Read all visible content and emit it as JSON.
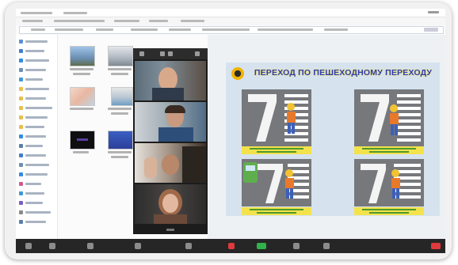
{
  "slide": {
    "title": "ПЕРЕХОД ПО ПЕШЕХОДНОМУ ПЕРЕХОДУ",
    "title_color": "#2b3db4",
    "title_glow": "#f6e25a",
    "background": "#d6e3ee",
    "caption_color": "#f3e24c",
    "caption_text_color": "#4d9a2c",
    "panels": [
      {
        "illustration": "pedestrian-crossing-child"
      },
      {
        "illustration": "pedestrian-crossing-child"
      },
      {
        "illustration": "pedestrian-crossing-child-with-car"
      },
      {
        "illustration": "pedestrian-crossing-child"
      }
    ]
  },
  "explorer": {
    "nav_icons": [
      "quick-access-icon",
      "desktop-icon",
      "downloads-icon",
      "documents-icon",
      "pictures-icon",
      "folder-icon",
      "folder-icon",
      "folder-icon",
      "folder-icon",
      "folder-icon",
      "onedrive-icon",
      "this-pc-icon",
      "desktop-icon",
      "documents-icon",
      "downloads-icon",
      "music-icon",
      "pictures-icon",
      "videos-icon",
      "local-disk-icon",
      "network-icon"
    ],
    "thumbnails": [
      "image-file-icon",
      "image-file-icon",
      "image-file-icon",
      "image-file-icon",
      "video-file-icon",
      "presentation-file-icon"
    ]
  },
  "gallery": {
    "participants": [
      "participant-video",
      "participant-video",
      "participant-video",
      "participant-video"
    ]
  },
  "toolbar": {
    "background": "#262626",
    "icons": [
      {
        "name": "mute-icon",
        "color": "#8c8c8c"
      },
      {
        "name": "video-icon",
        "color": "#8c8c8c"
      },
      {
        "name": "security-icon",
        "color": "#8c8c8c"
      },
      {
        "name": "participants-icon",
        "color": "#8c8c8c"
      },
      {
        "name": "chat-icon",
        "color": "#8c8c8c"
      },
      {
        "name": "stop-share-icon",
        "color": "#e0393e"
      },
      {
        "name": "share-screen-icon",
        "color": "#2fb34a"
      },
      {
        "name": "record-icon",
        "color": "#8c8c8c"
      },
      {
        "name": "reactions-icon",
        "color": "#8c8c8c"
      },
      {
        "name": "end-meeting-icon",
        "color": "#e0393e"
      }
    ]
  }
}
